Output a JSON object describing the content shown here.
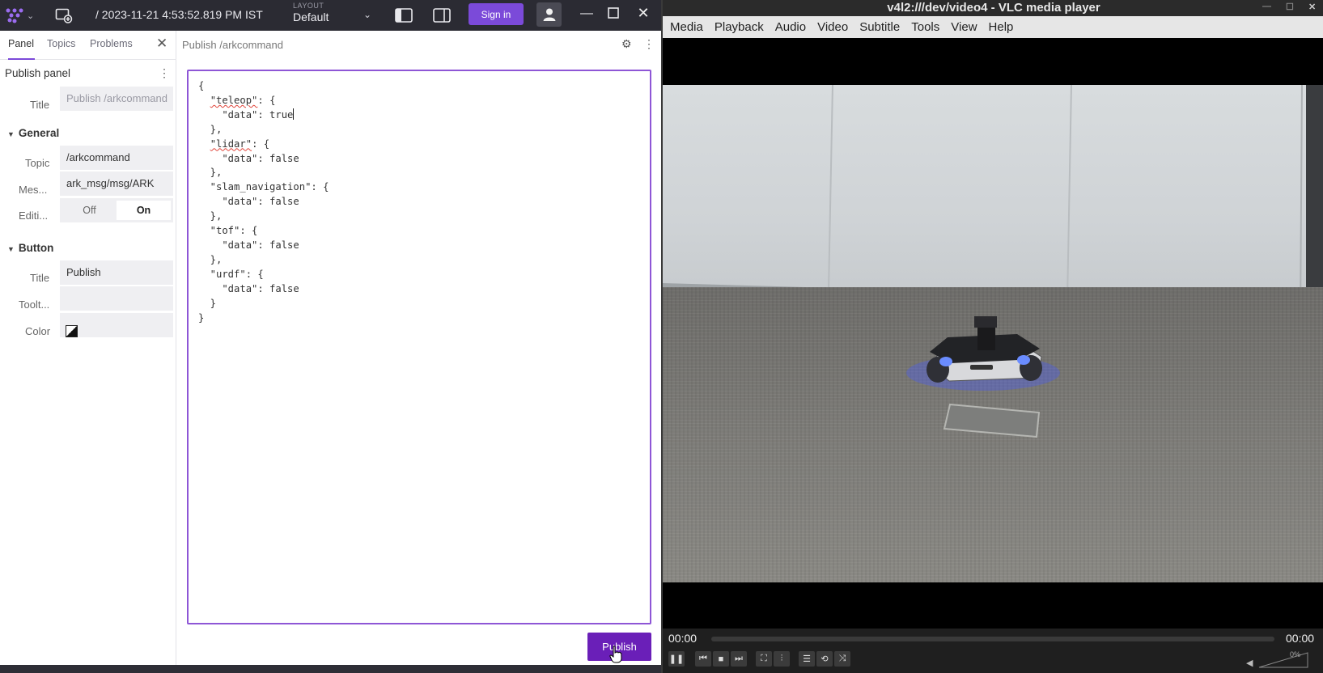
{
  "foxglove": {
    "datetime": "/ 2023-11-21 4:53:52.819 PM IST",
    "layout_label": "LAYOUT",
    "layout_value": "Default",
    "signin": "Sign in",
    "sidebar": {
      "tabs": [
        "Panel",
        "Topics",
        "Problems"
      ],
      "title": "Publish panel",
      "title_field_label": "Title",
      "title_field_placeholder": "Publish /arkcommand",
      "general_header": "General",
      "topic_label": "Topic",
      "topic_value": "/arkcommand",
      "message_label": "Mes...",
      "message_value": "ark_msg/msg/ARK",
      "editing_label": "Editi...",
      "editing_off": "Off",
      "editing_on": "On",
      "button_header": "Button",
      "button_title_label": "Title",
      "button_title_value": "Publish",
      "tooltip_label": "Toolt...",
      "tooltip_value": "",
      "color_label": "Color"
    },
    "panel": {
      "title": "Publish /arkcommand",
      "publish_button": "Publish",
      "json_lines": {
        "l1": "{",
        "l2_key": "\"teleop\"",
        "l2_rest": ": {",
        "l3": "    \"data\": true",
        "l4": "  },",
        "l5_key": "\"lidar\"",
        "l5_rest": ": {",
        "l6": "    \"data\": false",
        "l7": "  },",
        "l8": "  \"slam_navigation\": {",
        "l9": "    \"data\": false",
        "l10": "  },",
        "l11": "  \"tof\": {",
        "l12": "    \"data\": false",
        "l13": "  },",
        "l14": "  \"urdf\": {",
        "l15": "    \"data\": false",
        "l16": "  }",
        "l17": "}"
      }
    }
  },
  "vlc": {
    "title": "v4l2:///dev/video4 - VLC media player",
    "menu": [
      "Media",
      "Playback",
      "Audio",
      "Video",
      "Subtitle",
      "Tools",
      "View",
      "Help"
    ],
    "time_elapsed": "00:00",
    "time_total": "00:00",
    "volume": "0%"
  },
  "colors": {
    "accent": "#7b4ad9",
    "publish_button": "#6a1fb8",
    "editor_border": "#8e56d6"
  }
}
